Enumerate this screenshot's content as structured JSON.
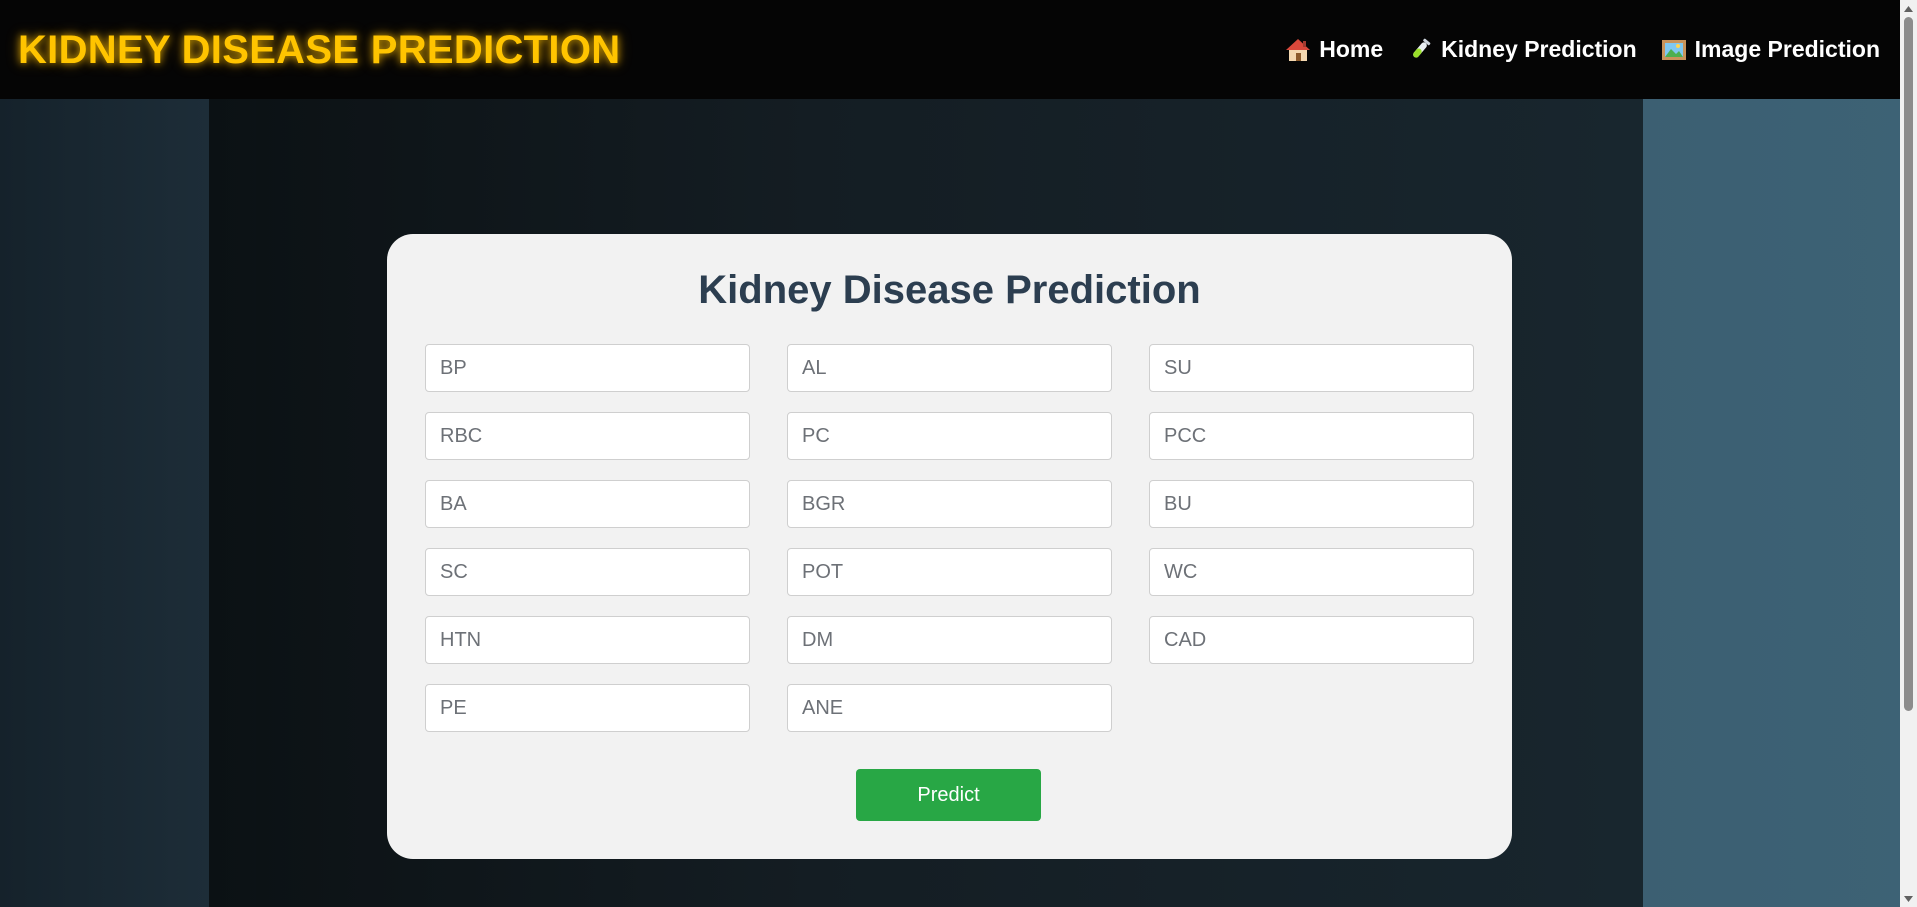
{
  "brand": {
    "title": "KIDNEY DISEASE PREDICTION"
  },
  "nav": {
    "items": [
      {
        "label": "Home",
        "icon": "house-icon"
      },
      {
        "label": "Kidney Prediction",
        "icon": "test-tube-icon"
      },
      {
        "label": "Image Prediction",
        "icon": "framed-picture-icon"
      }
    ]
  },
  "form": {
    "title": "Kidney Disease Prediction",
    "fields": [
      {
        "placeholder": "BP",
        "value": ""
      },
      {
        "placeholder": "AL",
        "value": ""
      },
      {
        "placeholder": "SU",
        "value": ""
      },
      {
        "placeholder": "RBC",
        "value": ""
      },
      {
        "placeholder": "PC",
        "value": ""
      },
      {
        "placeholder": "PCC",
        "value": ""
      },
      {
        "placeholder": "BA",
        "value": ""
      },
      {
        "placeholder": "BGR",
        "value": ""
      },
      {
        "placeholder": "BU",
        "value": ""
      },
      {
        "placeholder": "SC",
        "value": ""
      },
      {
        "placeholder": "POT",
        "value": ""
      },
      {
        "placeholder": "WC",
        "value": ""
      },
      {
        "placeholder": "HTN",
        "value": ""
      },
      {
        "placeholder": "DM",
        "value": ""
      },
      {
        "placeholder": "CAD",
        "value": ""
      },
      {
        "placeholder": "PE",
        "value": ""
      },
      {
        "placeholder": "ANE",
        "value": ""
      }
    ],
    "submit_label": "Predict"
  },
  "colors": {
    "brand": "#ffc400",
    "navbar_bg": "#050505",
    "card_bg": "#f2f2f2",
    "title_text": "#2c3e50",
    "button_bg": "#28a745"
  }
}
